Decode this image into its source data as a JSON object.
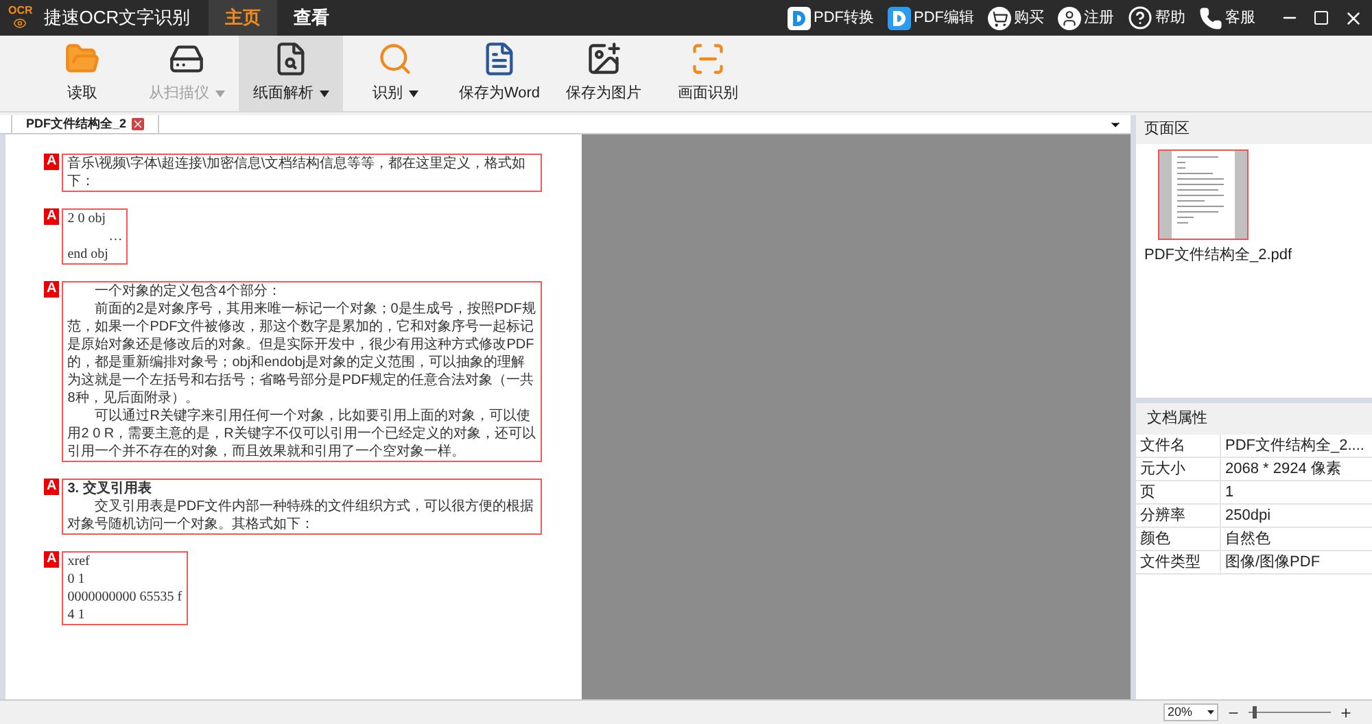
{
  "app": {
    "title": "捷速OCR文字识别",
    "logo": "OCR"
  },
  "tabs": [
    {
      "label": "主页",
      "selected": true
    },
    {
      "label": "查看",
      "selected": false
    }
  ],
  "top_links": [
    {
      "kind": "pdf-convert",
      "label": "PDF转换"
    },
    {
      "kind": "pdf-edit",
      "label": "PDF编辑"
    },
    {
      "kind": "cart",
      "label": "购买"
    },
    {
      "kind": "user",
      "label": "注册"
    },
    {
      "kind": "help",
      "label": "帮助"
    },
    {
      "kind": "phone",
      "label": "客服"
    }
  ],
  "toolbar": [
    {
      "kind": "open",
      "label": "读取",
      "disabled": false,
      "dropdown": false,
      "selected": false
    },
    {
      "kind": "scanner",
      "label": "从扫描仪",
      "disabled": true,
      "dropdown": true,
      "selected": false
    },
    {
      "kind": "analyze",
      "label": "纸面解析",
      "disabled": false,
      "dropdown": true,
      "selected": true
    },
    {
      "kind": "recognize",
      "label": "识别",
      "disabled": false,
      "dropdown": true,
      "selected": false
    },
    {
      "kind": "word",
      "label": "保存为Word",
      "disabled": false,
      "dropdown": false,
      "selected": false
    },
    {
      "kind": "image",
      "label": "保存为图片",
      "disabled": false,
      "dropdown": false,
      "selected": false
    },
    {
      "kind": "capture",
      "label": "画面识别",
      "disabled": false,
      "dropdown": false,
      "selected": false
    }
  ],
  "document_tab": {
    "title": "PDF文件结构全_2"
  },
  "page": {
    "blocks": [
      {
        "marker": "A",
        "items": [
          {
            "kind": "paragraph",
            "text": "音乐\\视频\\字体\\超连接\\加密信息\\文档结构信息等等，都在这里定义，格式如下："
          }
        ]
      },
      {
        "marker": "A",
        "items": [
          {
            "kind": "code",
            "text": "2 0 obj"
          },
          {
            "kind": "code-indent",
            "text": "…"
          },
          {
            "kind": "code",
            "text": "end obj"
          }
        ]
      },
      {
        "marker": "A",
        "items": [
          {
            "kind": "indent",
            "text": "一个对象的定义包含4个部分："
          },
          {
            "kind": "indent",
            "text": "前面的2是对象序号，其用来唯一标记一个对象；0是生成号，按照PDF规范，如果一个PDF文件被修改，那这个数字是累加的，它和对象序号一起标记是原始对象还是修改后的对象。但是实际开发中，很少有用这种方式修改PDF的，都是重新编排对象号；obj和endobj是对象的定义范围，可以抽象的理解为这就是一个左括号和右括号；省略号部分是PDF规定的任意合法对象（一共8种，见后面附录）。"
          },
          {
            "kind": "indent",
            "text": "可以通过R关键字来引用任何一个对象，比如要引用上面的对象，可以使用2 0 R，需要主意的是，R关键字不仅可以引用一个已经定义的对象，还可以引用一个并不存在的对象，而且效果就和引用了一个空对象一样。"
          }
        ]
      },
      {
        "marker": "A",
        "items": [
          {
            "kind": "heading",
            "text": "3. 交叉引用表"
          },
          {
            "kind": "indent",
            "text": "交叉引用表是PDF文件内部一种特殊的文件组织方式，可以很方便的根据对象号随机访问一个对象。其格式如下："
          }
        ]
      },
      {
        "marker": "A",
        "items": [
          {
            "kind": "code",
            "text": "xref"
          },
          {
            "kind": "code",
            "text": "0 1"
          },
          {
            "kind": "code",
            "text": "0000000000      65535      f"
          },
          {
            "kind": "code",
            "text": "4 1"
          }
        ]
      }
    ]
  },
  "pages_panel": {
    "title": "页面区",
    "thumbnails": [
      {
        "name": "PDF文件结构全_2.pdf",
        "selected": true
      }
    ]
  },
  "properties": {
    "title": "文档属性",
    "rows": [
      {
        "name": "文件名",
        "value": "PDF文件结构全_2...."
      },
      {
        "name": "元大小",
        "value": "2068 * 2924 像素"
      },
      {
        "name": "页",
        "value": "1"
      },
      {
        "name": "分辨率",
        "value": "250dpi"
      },
      {
        "name": "颜色",
        "value": "自然色"
      },
      {
        "name": "文件类型",
        "value": "图像/图像PDF"
      }
    ]
  },
  "status_bar": {
    "zoom": "20%",
    "level": 0.05
  }
}
